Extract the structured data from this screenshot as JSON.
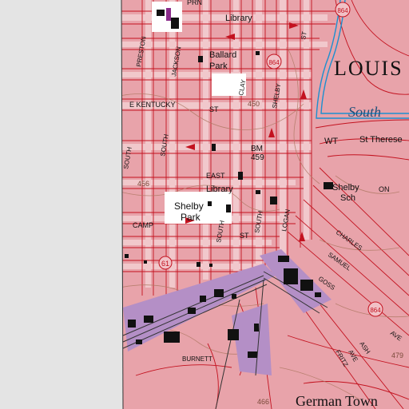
{
  "map": {
    "colors": {
      "urban": "#e8a3aa",
      "urban_light": "#f1c1c6",
      "offmap": "#e4e4e4",
      "street": "#f7e6e8",
      "grid_line": "#c3121f",
      "contour": "#b17a66",
      "water": "#1d8fcf",
      "industrial": "#b48fc6",
      "building": "#111111",
      "park": "#ffffff"
    },
    "labels": {
      "library_north": "Library",
      "ballard_park_1": "Ballard",
      "ballard_park_2": "Park",
      "louisville": "LOUIS",
      "south_1": "South",
      "st_therese": "St Therese",
      "wt": "WT",
      "bm": "BM",
      "bm_elev": "459",
      "elev_450": "450",
      "elev_456": "456",
      "elev_466": "466",
      "elev_479": "479",
      "library_south": "Library",
      "shelby_park_1": "Shelby",
      "shelby_park_2": "Park",
      "shelby_sch_1": "Shelby",
      "shelby_sch_2": "Sch",
      "st_on": "ON",
      "german_town": "German Town",
      "street_preston": "PRESTON",
      "street_jackson": "JACKSON",
      "street_clay": "CLAY",
      "street_shelby": "SHELBY",
      "street_st_a": "ST",
      "street_e_kentucky": "E KENTUCKY",
      "street_st_b": "ST",
      "street_south_a": "SOUTH",
      "street_east": "EAST",
      "street_camp": "CAMP",
      "street_south_b": "SOUTH",
      "street_st_c": "ST",
      "street_logan": "LOGAN",
      "street_charles": "CHARLES",
      "street_samuel": "SAMUEL",
      "street_goss": "GOSS",
      "street_ave": "AVE",
      "street_ash": "ASH",
      "street_burnett": "BURNETT",
      "street_fritz": "FRITZ",
      "street_ave_b": "AVE",
      "route_61": "61",
      "route_864_a": "864",
      "route_864_b": "864",
      "route_864_c": "864",
      "top_label_a": "PRN"
    }
  }
}
